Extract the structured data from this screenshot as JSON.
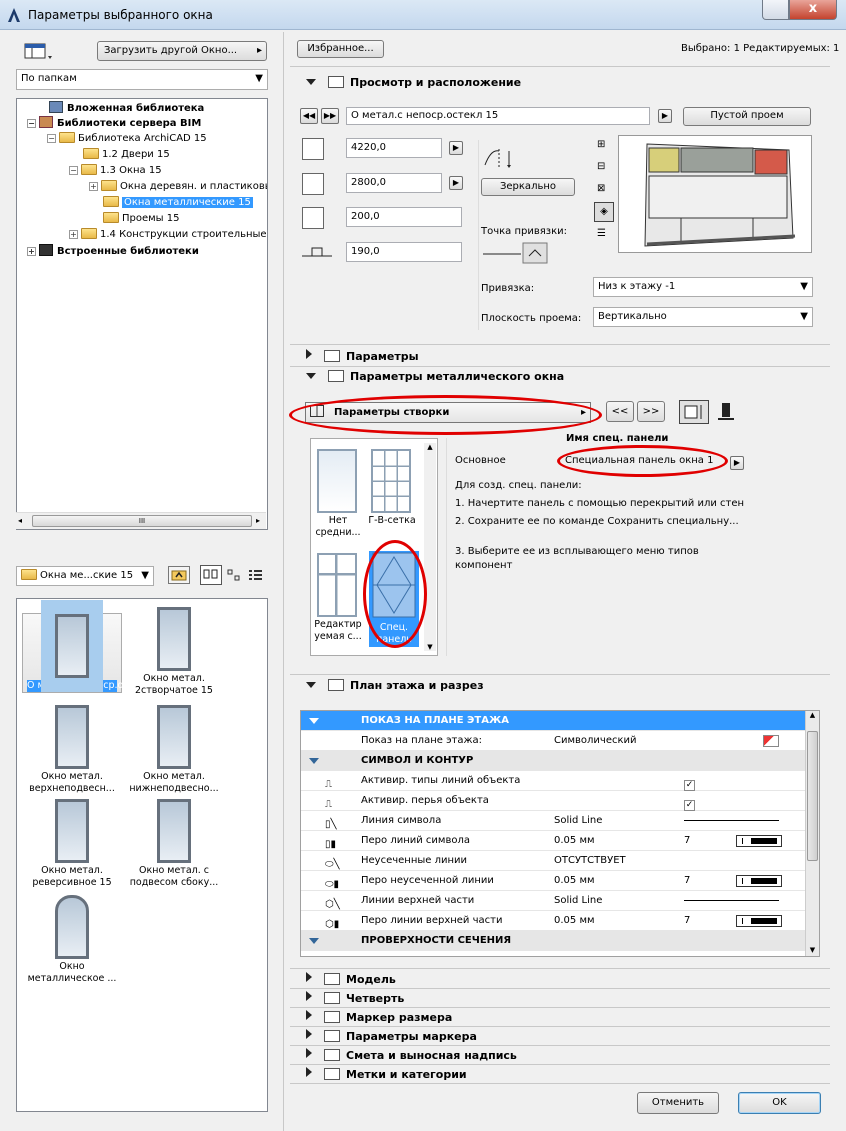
{
  "window": {
    "title": "Параметры выбранного окна",
    "close_glyph": "x"
  },
  "left": {
    "load_button": "Загрузить другой Окно...",
    "view_mode": "По папкам",
    "tree": [
      {
        "label": "Вложенная библиотека",
        "bold": true
      },
      {
        "label": "Библиотеки сервера BIM",
        "bold": true
      },
      {
        "label": "Библиотека ArchiCAD 15"
      },
      {
        "label": "1.2 Двери 15"
      },
      {
        "label": "1.3 Окна 15"
      },
      {
        "label": "Окна деревян. и пластиковые 15"
      },
      {
        "label": "Окна металлические 15",
        "selected": true
      },
      {
        "label": "Проемы 15"
      },
      {
        "label": "1.4 Конструкции строительные"
      },
      {
        "label": "Встроенные библиотеки",
        "bold": true
      }
    ],
    "scroll_grip": "III",
    "folder_select": "Окна ме...ские 15",
    "gallery": [
      {
        "label": "О метал.с непоср.остекл 15",
        "selected": true
      },
      {
        "label": "Окно метал. 2створчатое 15"
      },
      {
        "label": "Окно метал. верхнеподвесн..."
      },
      {
        "label": "Окно метал. нижнеподвесно..."
      },
      {
        "label": "Окно метал. реверсивное 15"
      },
      {
        "label": "Окно метал. с подвесом сбоку..."
      },
      {
        "label": "Окно металлическое ..."
      }
    ]
  },
  "right": {
    "favorites": "Избранное...",
    "selected_info": "Выбрано: 1 Редактируемых: 1",
    "view_section": "Просмотр и расположение",
    "object_name": "О метал.с непоср.остекл 15",
    "empty_opening": "Пустой проем",
    "width": "4220,0",
    "height": "2800,0",
    "sill": "200,0",
    "reveal": "190,0",
    "mirror": "Зеркально",
    "anchor_point": "Точка привязки:",
    "anchor_label": "Привязка:",
    "anchor_value": "Низ к этажу -1",
    "plane_label": "Плоскость проема:",
    "plane_value": "Вертикально",
    "params_section": "Параметры",
    "metal_section": "Параметры металлического окна",
    "sash_params": "Параметры створки",
    "nav_prev": "<<",
    "nav_next": ">>",
    "panel_name_title": "Имя спец. панели",
    "main_label": "Основное",
    "panel_value": "Специальная панель окна 1",
    "instructions": [
      "Для созд. спец. панели:",
      "1. Начертите панель с помощью перекрытий или стен",
      "2. Сохраните ее по команде Сохранить специальну...",
      "3. Выберите ее из всплывающего меню типов компонент"
    ],
    "sash_types": [
      {
        "label": "Нет средни..."
      },
      {
        "label": "Г-В-сетка"
      },
      {
        "label": "Редактир уемая с..."
      },
      {
        "label": "Спец. панель",
        "selected": true
      }
    ],
    "plan_section": "План этажа и разрез",
    "grid_rows": [
      {
        "type": "group",
        "label": "ПОКАЗ НА ПЛАНЕ ЭТАЖА",
        "selected": true
      },
      {
        "label": "Показ на плане этажа:",
        "value": "Символический"
      },
      {
        "type": "group",
        "label": "СИМВОЛ И КОНТУР"
      },
      {
        "label": "Активир. типы линий объекта",
        "check": "✓"
      },
      {
        "label": "Активир. перья объекта",
        "check": "✓"
      },
      {
        "label": "Линия символа",
        "value": "Solid Line",
        "line": true
      },
      {
        "label": "Перо линий символа",
        "value": "0.05 мм",
        "num": "7",
        "pen": true
      },
      {
        "label": "Неусеченные линии",
        "value": "ОТСУТСТВУЕТ"
      },
      {
        "label": "Перо неусеченной линии",
        "value": "0.05 мм",
        "num": "7",
        "pen": true
      },
      {
        "label": "Линии верхней части",
        "value": "Solid Line",
        "line": true
      },
      {
        "label": "Перо линии верхней части",
        "value": "0.05 мм",
        "num": "7",
        "pen": true
      },
      {
        "type": "group",
        "label": "ПРОВЕРХНОСТИ СЕЧЕНИЯ"
      }
    ],
    "collapsed_sections": [
      "Модель",
      "Четверть",
      "Маркер размера",
      "Параметры маркера",
      "Смета и выносная надпись",
      "Метки и категории"
    ],
    "cancel": "Отменить",
    "ok": "OK"
  },
  "colors": {
    "selection": "#3399ff",
    "annotation": "#e00000"
  }
}
